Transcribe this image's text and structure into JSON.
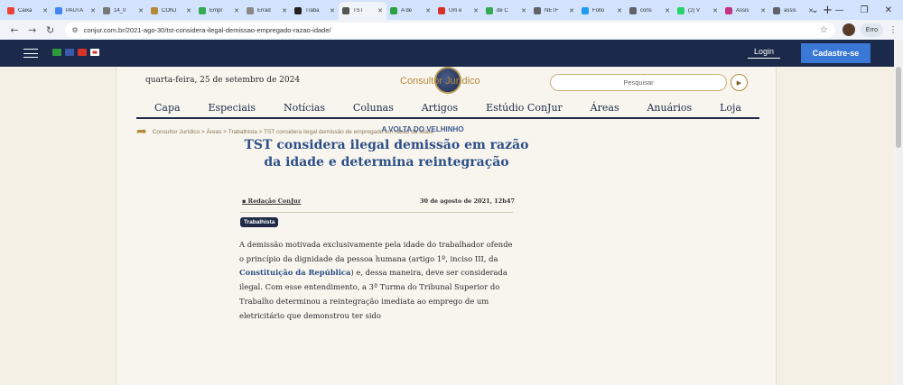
{
  "browser": {
    "tabs": [
      {
        "title": "Caixa",
        "color": "#ea4335"
      },
      {
        "title": "PAUTA",
        "color": "#4285f4"
      },
      {
        "title": "14_0",
        "color": "#777777"
      },
      {
        "title": "CONJ",
        "color": "#b38a3a"
      },
      {
        "title": "Empr",
        "color": "#34a853"
      },
      {
        "title": "Errad",
        "color": "#888888"
      },
      {
        "title": "Traba",
        "color": "#222222"
      },
      {
        "title": "TST",
        "color": "#555555"
      },
      {
        "title": "A de",
        "color": "#2ea043"
      },
      {
        "title": "Um e",
        "color": "#d93025"
      },
      {
        "title": "de C",
        "color": "#34a853"
      },
      {
        "title": "NETF",
        "color": "#5f6368"
      },
      {
        "title": "Follo",
        "color": "#1d9bf0"
      },
      {
        "title": "cons",
        "color": "#5f6368"
      },
      {
        "title": "(2) V",
        "color": "#25d366"
      },
      {
        "title": "Assis",
        "color": "#c13584"
      },
      {
        "title": "assis",
        "color": "#5f6368"
      }
    ],
    "active_tab": 7,
    "new_tab": "+",
    "window_controls": [
      "⌄",
      "—",
      "❐",
      "✕"
    ],
    "url": "conjur.com.br/2021-ago-30/tst-considera-ilegal-demissao-empregado-razao-idade/",
    "error_label": "Erro"
  },
  "site": {
    "login": "Login",
    "signup": "Cadastre-se",
    "date": "quarta-feira, 25 de setembro de 2024",
    "logo": "Consultor Jurídico",
    "search_placeholder": "Pesquisar",
    "flags": [
      {
        "name": "brazil-flag-icon",
        "color": "#2e9a3c"
      },
      {
        "name": "usa-flag-icon",
        "color": "#3d5aa8"
      },
      {
        "name": "spain-flag-icon",
        "color": "#d8332a"
      },
      {
        "name": "japan-flag-icon",
        "color": "#ffffff"
      }
    ],
    "menu": [
      "Capa",
      "Especiais",
      "Notícias",
      "Colunas",
      "Artigos",
      "Estúdio ConJur",
      "Áreas",
      "Anuários",
      "Loja"
    ],
    "breadcrumb": "Consultor Jurídico > Áreas > Trabalhista > TST considera ilegal demissão de empregado em razão da idade"
  },
  "article": {
    "kicker": "A VOLTA DO VELHINHO",
    "headline": "TST considera ilegal demissão em razão da idade e determina reintegração",
    "author": "Redação ConJur",
    "date": "30 de agosto de 2021, 12h47",
    "tag": "Trabalhista",
    "p_before_link": "A demissão motivada exclusivamente pela idade do trabalhador ofende o princípio da dignidade da pessoa humana (artigo 1º, inciso III, da ",
    "link": "Constituição da República",
    "p_after_link": ") e, dessa maneira, deve ser considerada ilegal. Com esse entendimento, a 3ª Turma do Tribunal Superior do Trabalho determinou a reintegração imediata ao emprego de um eletricitário que demonstrou ter sido"
  }
}
